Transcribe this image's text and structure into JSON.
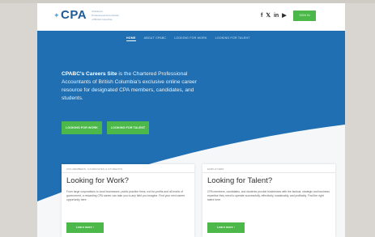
{
  "header": {
    "logo_text": "CPA",
    "logo_tagline": [
      "Chartered",
      "Professional Accountants",
      "of British Columbia"
    ],
    "social": [
      "f",
      "𝕏",
      "in",
      "▶"
    ],
    "signin_label": "SIGN IN"
  },
  "nav": {
    "items": [
      "HOME",
      "ABOUT CPABC",
      "LOOKING FOR WORK",
      "LOOKING FOR TALENT"
    ]
  },
  "hero": {
    "lead": "CPABC's Careers Site",
    "text": " is the Chartered Professional Accountants of British Columbia's exclusive online career resource for designated CPA members, candidates, and students.",
    "btn_work": "LOOKING FOR WORK",
    "btn_talent": "LOOKING FOR TALENT"
  },
  "cards": [
    {
      "tag": "CPA MEMBERS, CANDIDATES & STUDENTS",
      "title": "Looking for Work?",
      "body": "From large corporations to local businesses, public practice firms, not-for-profits and all levels of government, a rewarding CPA career can take you to any field you imagine. Find your next career opportunity here.",
      "button": "Learn more ›"
    },
    {
      "tag": "EMPLOYERS",
      "title": "Looking for Talent?",
      "body": "CPA members, candidates, and students provide businesses with the tactical, strategic and business expertise they need to operate successfully, effectively, sustainably, and profitably. Find the right talent here.",
      "button": "Learn more ›"
    }
  ],
  "colors": {
    "brand_blue": "#1f6fb2",
    "accent_green": "#4cb84a"
  }
}
